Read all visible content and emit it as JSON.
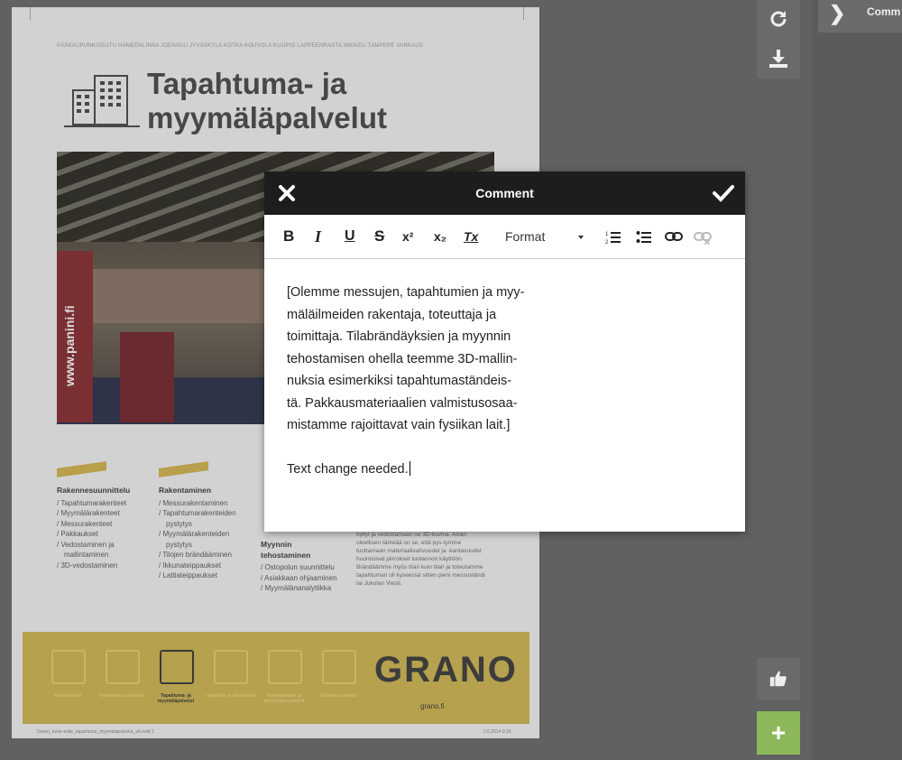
{
  "document": {
    "cities": "PÄÄKAUPUNKISEUTU HÄMEENLINNA JOENSUU JYVÄSKYLÄ KOTKA KOUVOLA KUOPIO LAPPEENRANTA MIKKELI TAMPERE VARKAUS",
    "title_line1": "Tapahtuma- ja",
    "title_line2": "myymäläpalvelut",
    "photo_sign": "www.panini.fi",
    "columns": [
      {
        "heading": "Rakennesuunnittelu",
        "items": [
          "Tapahtumarakenteet",
          "Myymälärakenteet",
          "Messurakenteet",
          "Pakkaukset",
          "Vedostaminen ja mallintaminen",
          "3D-vedostaminen"
        ]
      },
      {
        "heading": "Rakentaminen",
        "items": [
          "Messurakentaminen",
          "Tapahtumarakentei­den pystytys",
          "Myymälärakentei­den pystytys",
          "Tilojen brändääminen",
          "Ikkunateippaukset",
          "Lattiateippaukset"
        ]
      },
      {
        "heading": "Myynnin tehostaminen",
        "items": [
          "Ostopolun suunnittelu",
          "Asiakkaan ohjaaminen",
          "Myymälänanalytiikka"
        ]
      }
    ],
    "text_col": "hyllyt ja vedostamaan ne 3D-kuvina. Aivan oleellisen tärkeää on se, että pys-tymme tuottamaan materiaalivahvuudet ja -kantavuudet huomioivat piirrokset tuotannon käyttöön. Brändäämme myös tilan kuin tilan ja toteutamme tapahtuman oli kyseessä sitten pieni messuständi tai Jukolan Viesti.",
    "icons": [
      {
        "label": "Painopalvelut",
        "active": false
      },
      {
        "label": "Markkinoinnin palvelut",
        "active": false
      },
      {
        "label": "Tapahtuma- ja myymäläpalvelut",
        "active": true
      },
      {
        "label": "Logistiikka ja ulkoistukset",
        "active": false
      },
      {
        "label": "Rakentamisen ja kiinteistöjen palvelut",
        "active": false
      },
      {
        "label": "Sähköiset palvelut",
        "active": false
      }
    ],
    "brand": "GRANO",
    "brand_url": "grano.fi",
    "footer_left": "Grano_tuote-esite_tapahtuma_myymalapalvelut_a4.indd 1",
    "footer_right": "2.6.2014 9.29"
  },
  "sidepanel": {
    "label": "Comm"
  },
  "dialog": {
    "title": "Comment",
    "toolbar": {
      "bold": "B",
      "italic": "I",
      "underline": "U",
      "strike": "S",
      "superscript": "x²",
      "subscript": "x₂",
      "clear_format": "Tx",
      "format_label": "Format"
    },
    "body_lines": [
      "[Olemme messujen, tapahtumien ja myy-",
      "mäläilmeiden rakentaja, toteuttaja ja",
      "toimittaja. Tilabrändäyksien ja myynnin",
      "tehostamisen ohella teemme 3D-mallin-",
      "nuksia esimerkiksi tapahtumaständeis-",
      "tä. Pakkausmateriaalien valmistusosaa-",
      "mistamme rajoittavat vain fysiikan lait.]"
    ],
    "comment_text": "Text change needed."
  },
  "icons": {
    "refresh": "refresh-icon",
    "download": "download-icon",
    "like": "thumbs-up-icon",
    "add": "plus-icon",
    "close": "close-icon",
    "confirm": "check-icon",
    "panel": "chevron-right-icon"
  }
}
